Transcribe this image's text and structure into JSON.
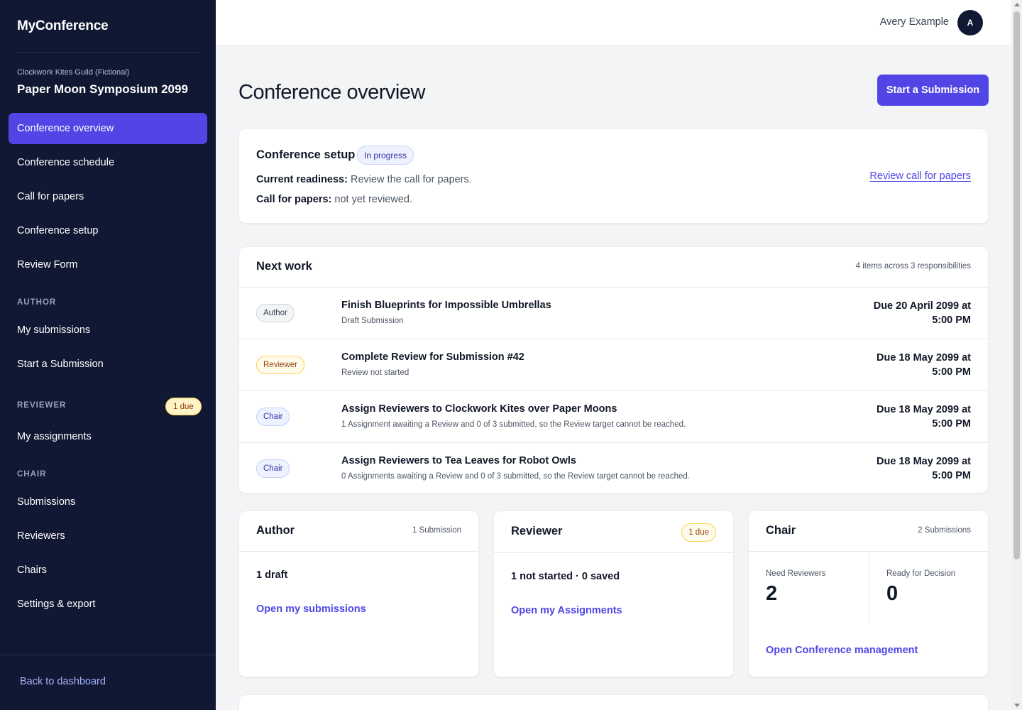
{
  "app": {
    "brand": "MyConference"
  },
  "conference": {
    "org": "Clockwork Kites Guild (Fictional)",
    "name": "Paper Moon Symposium 2099"
  },
  "nav": {
    "main": [
      {
        "label": "Conference overview",
        "active": true
      },
      {
        "label": "Conference schedule"
      },
      {
        "label": "Call for papers"
      },
      {
        "label": "Conference setup"
      },
      {
        "label": "Review Form"
      }
    ],
    "author_heading": "AUTHOR",
    "author": [
      {
        "label": "My submissions"
      },
      {
        "label": "Start a Submission"
      }
    ],
    "reviewer_heading": "REVIEWER",
    "reviewer_badge": "1 due",
    "reviewer": [
      {
        "label": "My assignments"
      }
    ],
    "chair_heading": "CHAIR",
    "chair": [
      {
        "label": "Submissions"
      },
      {
        "label": "Reviewers"
      },
      {
        "label": "Chairs"
      },
      {
        "label": "Settings & export"
      }
    ],
    "back_label": "Back to dashboard"
  },
  "user": {
    "name": "Avery Example",
    "initial": "A"
  },
  "page": {
    "title": "Conference overview",
    "primary_action": "Start a Submission"
  },
  "setup": {
    "title": "Conference setup",
    "status": "In progress",
    "readiness_label": "Current readiness:",
    "readiness_value": " Review the call for papers.",
    "cfp_label": "Call for papers:",
    "cfp_value": " not yet reviewed.",
    "link": "Review call for papers"
  },
  "next_work": {
    "title": "Next work",
    "meta": "4 items across 3 responsibilities",
    "items": [
      {
        "role": "Author",
        "title": "Finish Blueprints for Impossible Umbrellas",
        "subtitle": "Draft Submission",
        "due_line1": "Due 20 April 2099 at",
        "due_line2": "5:00 PM"
      },
      {
        "role": "Reviewer",
        "title": "Complete Review for Submission #42",
        "subtitle": "Review not started",
        "due_line1": "Due 18 May 2099 at",
        "due_line2": "5:00 PM"
      },
      {
        "role": "Chair",
        "title": "Assign Reviewers to Clockwork Kites over Paper Moons",
        "subtitle": "1 Assignment awaiting a Review and 0 of 3 submitted, so the Review target cannot be reached.",
        "due_line1": "Due 18 May 2099 at",
        "due_line2": "5:00 PM"
      },
      {
        "role": "Chair",
        "title": "Assign Reviewers to Tea Leaves for Robot Owls",
        "subtitle": "0 Assignments awaiting a Review and 0 of 3 submitted, so the Review target cannot be reached.",
        "due_line1": "Due 18 May 2099 at",
        "due_line2": "5:00 PM"
      }
    ]
  },
  "author_card": {
    "title": "Author",
    "meta": "1 Submission",
    "status": "1 draft",
    "link": "Open my submissions"
  },
  "reviewer_card": {
    "title": "Reviewer",
    "badge": "1 due",
    "status": "1 not started · 0 saved",
    "link": "Open my Assignments"
  },
  "chair_card": {
    "title": "Chair",
    "meta": "2 Submissions",
    "stats": [
      {
        "label": "Need Reviewers",
        "value": "2"
      },
      {
        "label": "Ready for Decision",
        "value": "0"
      }
    ],
    "link": "Open Conference management"
  },
  "colors": {
    "sidebar": "#111833",
    "accent": "#5146e5",
    "link": "#4f46e5",
    "warning_bg": "#fef3c7"
  }
}
